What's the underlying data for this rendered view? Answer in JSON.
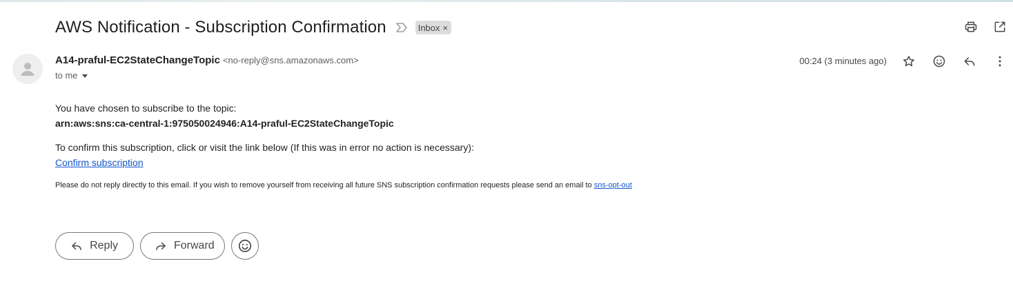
{
  "email": {
    "subject": "AWS Notification - Subscription Confirmation",
    "label": "Inbox",
    "label_remove": "×",
    "sender_name": "A14-praful-EC2StateChangeTopic",
    "sender_email": "<no-reply@sns.amazonaws.com>",
    "recipient_line": "to me",
    "timestamp": "00:24 (3 minutes ago)"
  },
  "body": {
    "intro": "You have chosen to subscribe to the topic:",
    "topic_arn": "arn:aws:sns:ca-central-1:975050024946:A14-praful-EC2StateChangeTopic",
    "confirm_instructions": "To confirm this subscription, click or visit the link below (If this was in error no action is necessary):",
    "confirm_link": "Confirm subscription",
    "footer_text": "Please do not reply directly to this email. If you wish to remove yourself from receiving all future SNS subscription confirmation requests please send an email to ",
    "opt_out_link": "sns-opt-out"
  },
  "actions": {
    "reply_label": "Reply",
    "forward_label": "Forward"
  },
  "icons": {
    "importance": "importance-marker-icon",
    "print": "print-icon",
    "open_new_window": "open-in-new-window-icon",
    "star": "star-icon",
    "emoji": "emoji-reaction-icon",
    "reply": "reply-icon",
    "more": "more-vertical-icon",
    "forward": "forward-icon",
    "avatar": "default-avatar-icon"
  },
  "colors": {
    "link": "#1155cc",
    "chip_bg": "#dddddd",
    "text": "#1f1f1f",
    "secondary_text": "#5e5e5e"
  }
}
